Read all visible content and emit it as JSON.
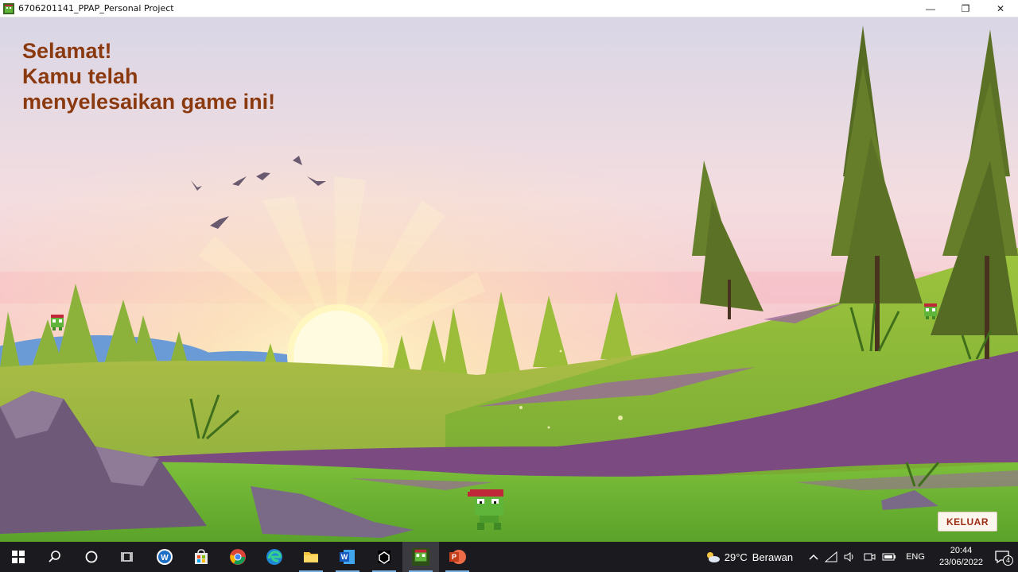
{
  "window": {
    "title": "6706201141_PPAP_Personal Project",
    "controls": {
      "minimize": "—",
      "maximize": "❐",
      "close": "✕"
    }
  },
  "game": {
    "message_lines": [
      "Selamat!",
      "Kamu telah",
      "menyelesaikan game ini!"
    ],
    "exit_button": "KELUAR"
  },
  "taskbar": {
    "apps": [
      "start",
      "search",
      "cortana",
      "task-view",
      "app-w",
      "store",
      "chrome",
      "edge",
      "file-explorer",
      "word",
      "unity",
      "game",
      "powerpoint"
    ],
    "active_app": "game",
    "weather": {
      "temp": "29°C",
      "desc": "Berawan"
    },
    "language": "ENG",
    "time": "20:44",
    "date": "23/06/2022",
    "notifications": "4"
  }
}
